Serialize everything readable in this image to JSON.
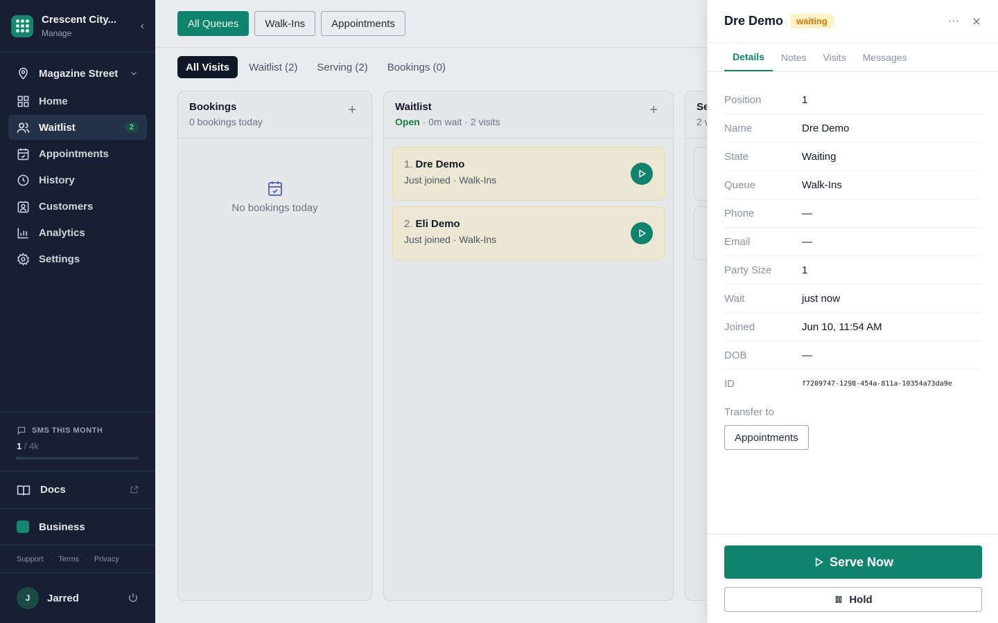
{
  "brand": {
    "name": "Crescent City...",
    "subtitle": "Manage"
  },
  "location": {
    "name": "Magazine Street"
  },
  "nav": [
    {
      "label": "Home",
      "icon": "home-icon"
    },
    {
      "label": "Waitlist",
      "icon": "users-icon",
      "badge": "2"
    },
    {
      "label": "Appointments",
      "icon": "calendar-icon"
    },
    {
      "label": "History",
      "icon": "clock-icon"
    },
    {
      "label": "Customers",
      "icon": "contact-icon"
    },
    {
      "label": "Analytics",
      "icon": "bar-chart-icon"
    },
    {
      "label": "Settings",
      "icon": "gear-icon"
    }
  ],
  "sms": {
    "title": "SMS THIS MONTH",
    "used": "1",
    "total": " / 4k",
    "fraction_used": 0.00025
  },
  "docs": {
    "label": "Docs"
  },
  "business": {
    "label": "Business"
  },
  "legal": {
    "support": "Support",
    "terms": "Terms",
    "privacy": "Privacy"
  },
  "user": {
    "initial": "J",
    "name": "Jarred"
  },
  "queues": [
    "All Queues",
    "Walk-Ins",
    "Appointments"
  ],
  "filters": [
    "All Visits",
    "Waitlist (2)",
    "Serving (2)",
    "Bookings (0)"
  ],
  "columns": {
    "bookings": {
      "title": "Bookings",
      "subtitle": "0 bookings today",
      "empty": "No bookings today"
    },
    "waitlist": {
      "title": "Waitlist",
      "status": "Open",
      "subtitle": " · 0m wait · 2 visits"
    },
    "serving": {
      "title": "Se",
      "subtitle": "2 v"
    }
  },
  "visits": [
    {
      "num": "1.",
      "name": "Dre Demo",
      "meta": "Just joined · Walk-Ins"
    },
    {
      "num": "2.",
      "name": "Eli Demo",
      "meta": "Just joined · Walk-Ins"
    }
  ],
  "panel": {
    "name": "Dre Demo",
    "state": "waiting",
    "tabs": [
      "Details",
      "Notes",
      "Visits",
      "Messages"
    ],
    "details": [
      {
        "label": "Position",
        "value": "1"
      },
      {
        "label": "Name",
        "value": "Dre Demo"
      },
      {
        "label": "State",
        "value": "Waiting"
      },
      {
        "label": "Queue",
        "value": "Walk-Ins"
      },
      {
        "label": "Phone",
        "value": "—"
      },
      {
        "label": "Email",
        "value": "—"
      },
      {
        "label": "Party Size",
        "value": "1"
      },
      {
        "label": "Wait",
        "value": "just now"
      },
      {
        "label": "Joined",
        "value": "Jun 10, 11:54 AM"
      },
      {
        "label": "DOB",
        "value": "—"
      },
      {
        "label": "ID",
        "value": "f7209747-1298-454a-811a-10354a73da9e"
      }
    ],
    "transfer_label": "Transfer to",
    "transfer_target": "Appointments",
    "serve_label": "Serve Now",
    "hold_label": "Hold"
  },
  "colors": {
    "accent": "#10836f",
    "sidebar": "#162032",
    "waiting_bg": "#fef3c7",
    "waiting_fg": "#d97706",
    "open": "#15803d"
  }
}
